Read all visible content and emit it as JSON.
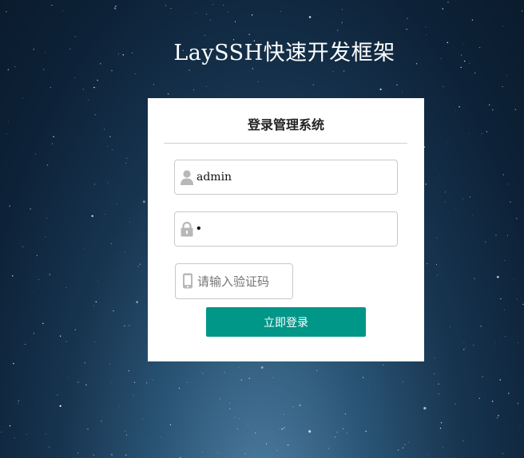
{
  "app": {
    "title": "LaySSH快速开发框架"
  },
  "login": {
    "title": "登录管理系统",
    "username": {
      "value": "admin",
      "icon": "user-icon"
    },
    "password": {
      "value": "•",
      "icon": "lock-icon"
    },
    "captcha": {
      "value": "",
      "placeholder": "请输入验证码",
      "icon": "phone-icon"
    },
    "submit_label": "立即登录"
  },
  "colors": {
    "button": "#009688",
    "panel": "#ffffff",
    "sky_top": "#0a1b2d",
    "sky_glow": "#4f7ea0",
    "icon": "#b8b8b8"
  }
}
